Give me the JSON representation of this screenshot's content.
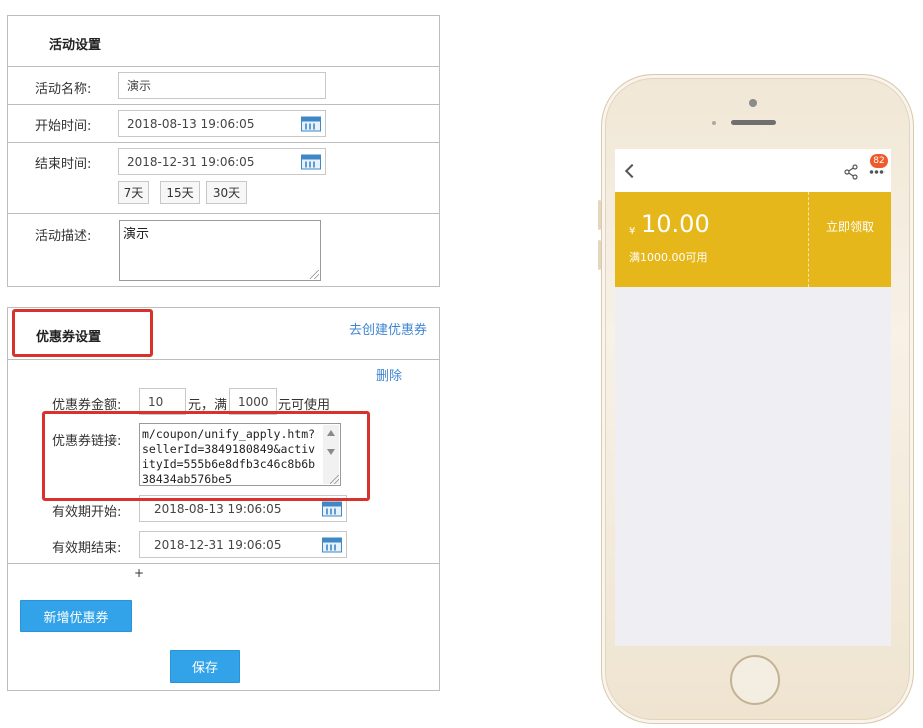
{
  "activity": {
    "title": "活动设置",
    "name_label": "活动名称:",
    "name_value": "演示",
    "start_label": "开始时间:",
    "start_value": "2018-08-13 19:06:05",
    "end_label": "结束时间:",
    "end_value": "2018-12-31 19:06:05",
    "quick_ranges": [
      "7天",
      "15天",
      "30天"
    ],
    "desc_label": "活动描述:",
    "desc_value": "演示"
  },
  "coupon": {
    "title": "优惠券设置",
    "create_link": "去创建优惠券",
    "delete_link": "删除",
    "amount_label": "优惠券金额:",
    "amount_value": "10",
    "amount_unit_text": "元，满",
    "threshold_value": "1000",
    "threshold_suffix": "元可使用",
    "link_label": "优惠券链接:",
    "link_value": "m/coupon/unify_apply.htm?sellerId=3849180849&activityId=555b6e8dfb3c46c8b6b38434ab576be5",
    "valid_start_label": "有效期开始:",
    "valid_start_value": "2018-08-13 19:06:05",
    "valid_end_label": "有效期结束:",
    "valid_end_value": "2018-12-31 19:06:05",
    "plus_text": "+",
    "add_button": "新增优惠券",
    "save_button": "保存"
  },
  "phone": {
    "badge": "82",
    "currency": "¥",
    "amount": "10.00",
    "condition": "满1000.00可用",
    "claim": "立即领取"
  },
  "colors": {
    "accent_blue": "#32a3e9",
    "link_blue": "#3f86d2",
    "highlight_red": "#d9312b",
    "coupon_gold": "#e5b71a",
    "badge_orange": "#ef5a2c"
  }
}
